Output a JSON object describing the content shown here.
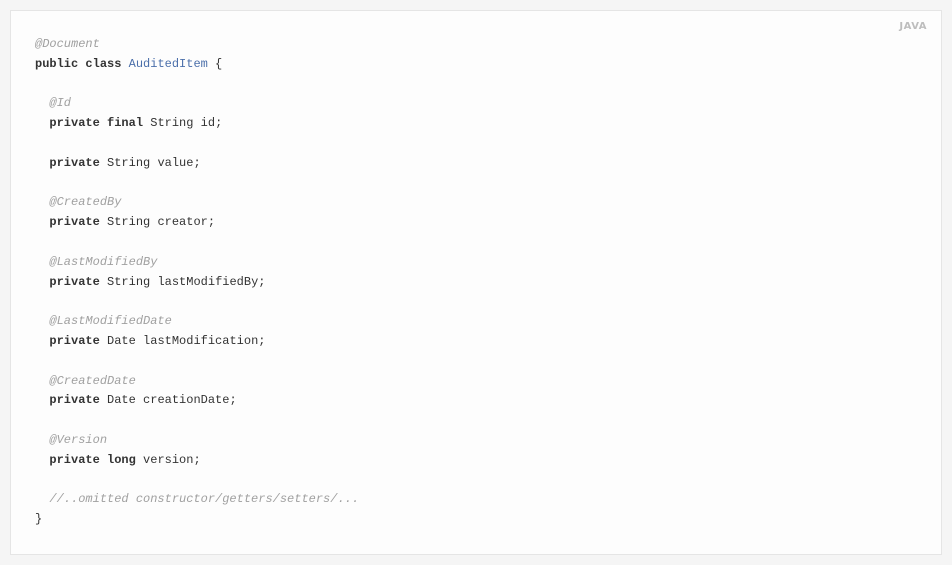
{
  "code": {
    "language": "JAVA",
    "annotations": {
      "document": "@Document",
      "id": "@Id",
      "createdBy": "@CreatedBy",
      "lastModifiedBy": "@LastModifiedBy",
      "lastModifiedDate": "@LastModifiedDate",
      "createdDate": "@CreatedDate",
      "version": "@Version"
    },
    "keywords": {
      "public": "public",
      "class": "class",
      "private": "private",
      "final": "final",
      "long": "long"
    },
    "types": {
      "string": "String",
      "date": "Date"
    },
    "className": "AuditedItem",
    "fields": {
      "id": "id",
      "value": "value",
      "creator": "creator",
      "lastModifiedBy": "lastModifiedBy",
      "lastModification": "lastModification",
      "creationDate": "creationDate",
      "version": "version"
    },
    "punctuation": {
      "openBrace": " {",
      "closeBrace": "}",
      "semi": ";"
    },
    "comment": "//..omitted constructor/getters/setters/..."
  }
}
